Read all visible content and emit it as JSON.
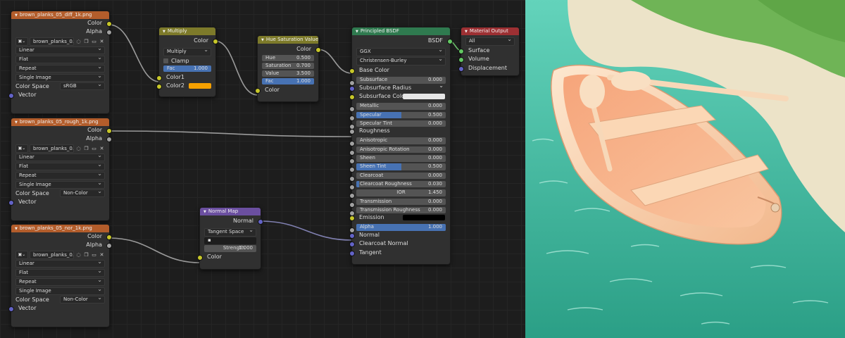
{
  "tex_diff": {
    "title": "brown_planks_05_diff_1k.png",
    "out_color": "Color",
    "out_alpha": "Alpha",
    "image": "brown_planks_0...",
    "interp": "Linear",
    "proj": "Flat",
    "ext": "Repeat",
    "source": "Single Image",
    "cs_label": "Color Space",
    "cs_value": "sRGB",
    "in_vector": "Vector"
  },
  "tex_rough": {
    "title": "brown_planks_05_rough_1k.png",
    "out_color": "Color",
    "out_alpha": "Alpha",
    "image": "brown_planks_0...",
    "interp": "Linear",
    "proj": "Flat",
    "ext": "Repeat",
    "source": "Single Image",
    "cs_label": "Color Space",
    "cs_value": "Non-Color",
    "in_vector": "Vector"
  },
  "tex_nor": {
    "title": "brown_planks_05_nor_1k.png",
    "out_color": "Color",
    "out_alpha": "Alpha",
    "image": "brown_planks_0...",
    "interp": "Linear",
    "proj": "Flat",
    "ext": "Repeat",
    "source": "Single Image",
    "cs_label": "Color Space",
    "cs_value": "Non-Color",
    "in_vector": "Vector"
  },
  "multiply": {
    "title": "Multiply",
    "out_color": "Color",
    "mode": "Multiply",
    "clamp": "Clamp",
    "fac_label": "Fac",
    "fac_value": "1.000",
    "fac_fraction": 1.0,
    "in_color1": "Color1",
    "in_color2": "Color2",
    "color2_hex": "#f5a000"
  },
  "hsv": {
    "title": "Hue Saturation Value",
    "out_color": "Color",
    "hue_label": "Hue",
    "hue_value": "0.500",
    "sat_label": "Saturation",
    "sat_value": "0.700",
    "val_label": "Value",
    "val_value": "3.500",
    "fac_label": "Fac",
    "fac_value": "1.000",
    "fac_fraction": 1.0,
    "in_color": "Color"
  },
  "normal_map": {
    "title": "Normal Map",
    "out_normal": "Normal",
    "space": "Tangent Space",
    "uv": "",
    "strength_label": "Strength",
    "strength_value": "1.000",
    "in_color": "Color"
  },
  "bsdf": {
    "title": "Principled BSDF",
    "out_bsdf": "BSDF",
    "distribution": "GGX",
    "sss_method": "Christensen-Burley",
    "base_color": "Base Color",
    "fields": [
      {
        "label": "Subsurface",
        "value": "0.000",
        "fraction": 0,
        "socket": "gray"
      },
      {
        "label": "Subsurface Radius",
        "value": "",
        "fraction": 0,
        "socket": "purple",
        "dropdown": true
      },
      {
        "label": "Subsurface Color",
        "value": "",
        "fraction": 0,
        "socket": "yellow",
        "swatch": "#e6e6e6"
      },
      {
        "label": "Metallic",
        "value": "0.000",
        "fraction": 0,
        "socket": "gray"
      },
      {
        "label": "Specular",
        "value": "0.500",
        "fraction": 0.5,
        "socket": "gray"
      },
      {
        "label": "Specular Tint",
        "value": "0.000",
        "fraction": 0,
        "socket": "gray"
      },
      {
        "label": "Roughness",
        "value": "",
        "fraction": 0,
        "socket": "gray",
        "linked": true
      },
      {
        "label": "Anisotropic",
        "value": "0.000",
        "fraction": 0,
        "socket": "gray"
      },
      {
        "label": "Anisotropic Rotation",
        "value": "0.000",
        "fraction": 0,
        "socket": "gray"
      },
      {
        "label": "Sheen",
        "value": "0.000",
        "fraction": 0,
        "socket": "gray"
      },
      {
        "label": "Sheen Tint",
        "value": "0.500",
        "fraction": 0.5,
        "socket": "gray"
      },
      {
        "label": "Clearcoat",
        "value": "0.000",
        "fraction": 0,
        "socket": "gray"
      },
      {
        "label": "Clearcoat Roughness",
        "value": "0.030",
        "fraction": 0.03,
        "socket": "gray"
      },
      {
        "label": "IOR",
        "value": "1.450",
        "fraction": 0,
        "socket": "gray",
        "center": true
      },
      {
        "label": "Transmission",
        "value": "0.000",
        "fraction": 0,
        "socket": "gray"
      },
      {
        "label": "Transmission Roughness",
        "value": "0.000",
        "fraction": 0,
        "socket": "gray"
      },
      {
        "label": "Emission",
        "value": "",
        "fraction": 0,
        "socket": "yellow",
        "swatch": "#000000"
      },
      {
        "label": "Alpha",
        "value": "1.000",
        "fraction": 1.0,
        "socket": "gray"
      }
    ],
    "normal": "Normal",
    "clearcoat_normal": "Clearcoat Normal",
    "tangent": "Tangent"
  },
  "output": {
    "title": "Material Output",
    "target": "All",
    "surface": "Surface",
    "volume": "Volume",
    "displacement": "Displacement"
  },
  "colors": {
    "image_header": "#b35d2b",
    "color_header": "#7d7a2a",
    "shader_header": "#2f7a4f",
    "output_header": "#9d3033",
    "vector_header": "#6b4fa0",
    "accent": "#4772b3"
  }
}
